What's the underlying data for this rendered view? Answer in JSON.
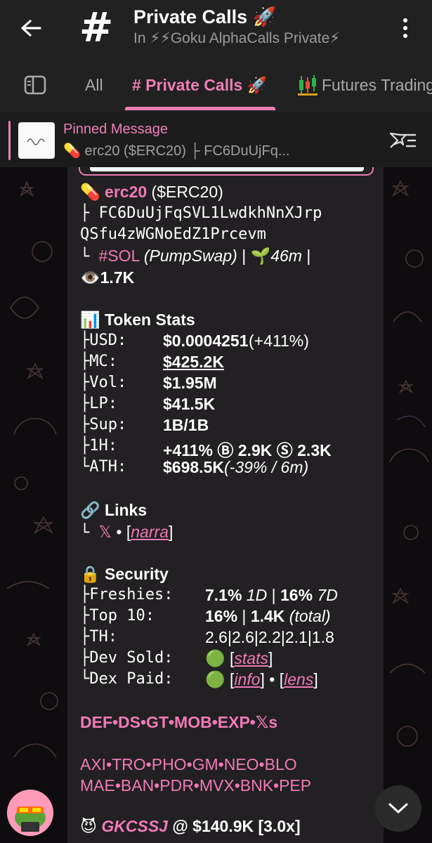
{
  "header": {
    "title": "Private Calls 🚀",
    "subtitle": "In ⚡⚡Goku AlphaCalls Private⚡",
    "avatar_glyph": "#"
  },
  "tabs": [
    {
      "label": "All"
    },
    {
      "label": "# Private Calls 🚀"
    },
    {
      "label": "Futures Trading"
    }
  ],
  "pinned": {
    "title": "Pinned Message",
    "text": "💊 erc20 ($ERC20)  ├ FC6DuUjFq..."
  },
  "message": {
    "token_name": "erc20",
    "token_symbol": "($ERC20)",
    "address_line1": "├ FC6DuUjFqSVL1LwdkhNnXJrp",
    "address_line2": "QSfu4zWGNoEdZ1Prcevm",
    "chain_prefix": "└ ",
    "chain": "#SOL",
    "dex": "(PumpSwap)",
    "age": "46m",
    "views": "1.7K",
    "stats_title": "Token Stats",
    "stats": [
      {
        "label": "├USD:",
        "value": "$0.0004251",
        "extra": " (+411%)"
      },
      {
        "label": "├MC:",
        "value": "$425.2K",
        "extra": ""
      },
      {
        "label": "├Vol:",
        "value": "$1.95M",
        "extra": ""
      },
      {
        "label": "├LP:",
        "value": "$41.5K",
        "extra": ""
      },
      {
        "label": "├Sup:",
        "value": "1B/1B",
        "extra": ""
      },
      {
        "label": "├1H:",
        "value": "+411% Ⓑ 2.9K Ⓢ 2.3K",
        "extra": ""
      },
      {
        "label": "└ATH:",
        "value": "$698.5K",
        "extra": " (-39% / 6m)"
      }
    ],
    "links_title": "Links",
    "links_prefix": "└ ",
    "links_x": "𝕏",
    "links_sep": " • [",
    "links_narra": "narra",
    "links_close": "]",
    "security_title": "Security",
    "security": {
      "freshies_label": "├Freshies:",
      "freshies_1": "7.1%",
      "freshies_1d": "1D",
      "freshies_sep": " | ",
      "freshies_2": "16%",
      "freshies_7d": "7D",
      "top10_label": "├Top 10:",
      "top10_1": "16%",
      "top10_sep": " | ",
      "top10_2": "1.4K",
      "top10_total": "(total)",
      "th_label": "├TH:",
      "th_value": "2.6|2.6|2.2|2.1|1.8",
      "devsold_label": "├Dev Sold:",
      "devsold_link": "stats",
      "dexpaid_label": "└Dex Paid:",
      "dexpaid_info": "info",
      "dexpaid_lens": "lens"
    },
    "links_row1": "DEF•DS•GT•MOB•EXP•𝕏s",
    "links_row2": "AXI•TRO•PHO•GM•NEO•BLO",
    "links_row3": "MAE•BAN•PDR•MVX•BNK•PEP",
    "caller_name": "GKCSSJ",
    "caller_rest": " @ $140.9K [3.0x]"
  },
  "colors": {
    "accent": "#ee7fb4",
    "header_bg": "#212121",
    "bubble_bg": "#222022",
    "green_dot": "#22c55e"
  }
}
